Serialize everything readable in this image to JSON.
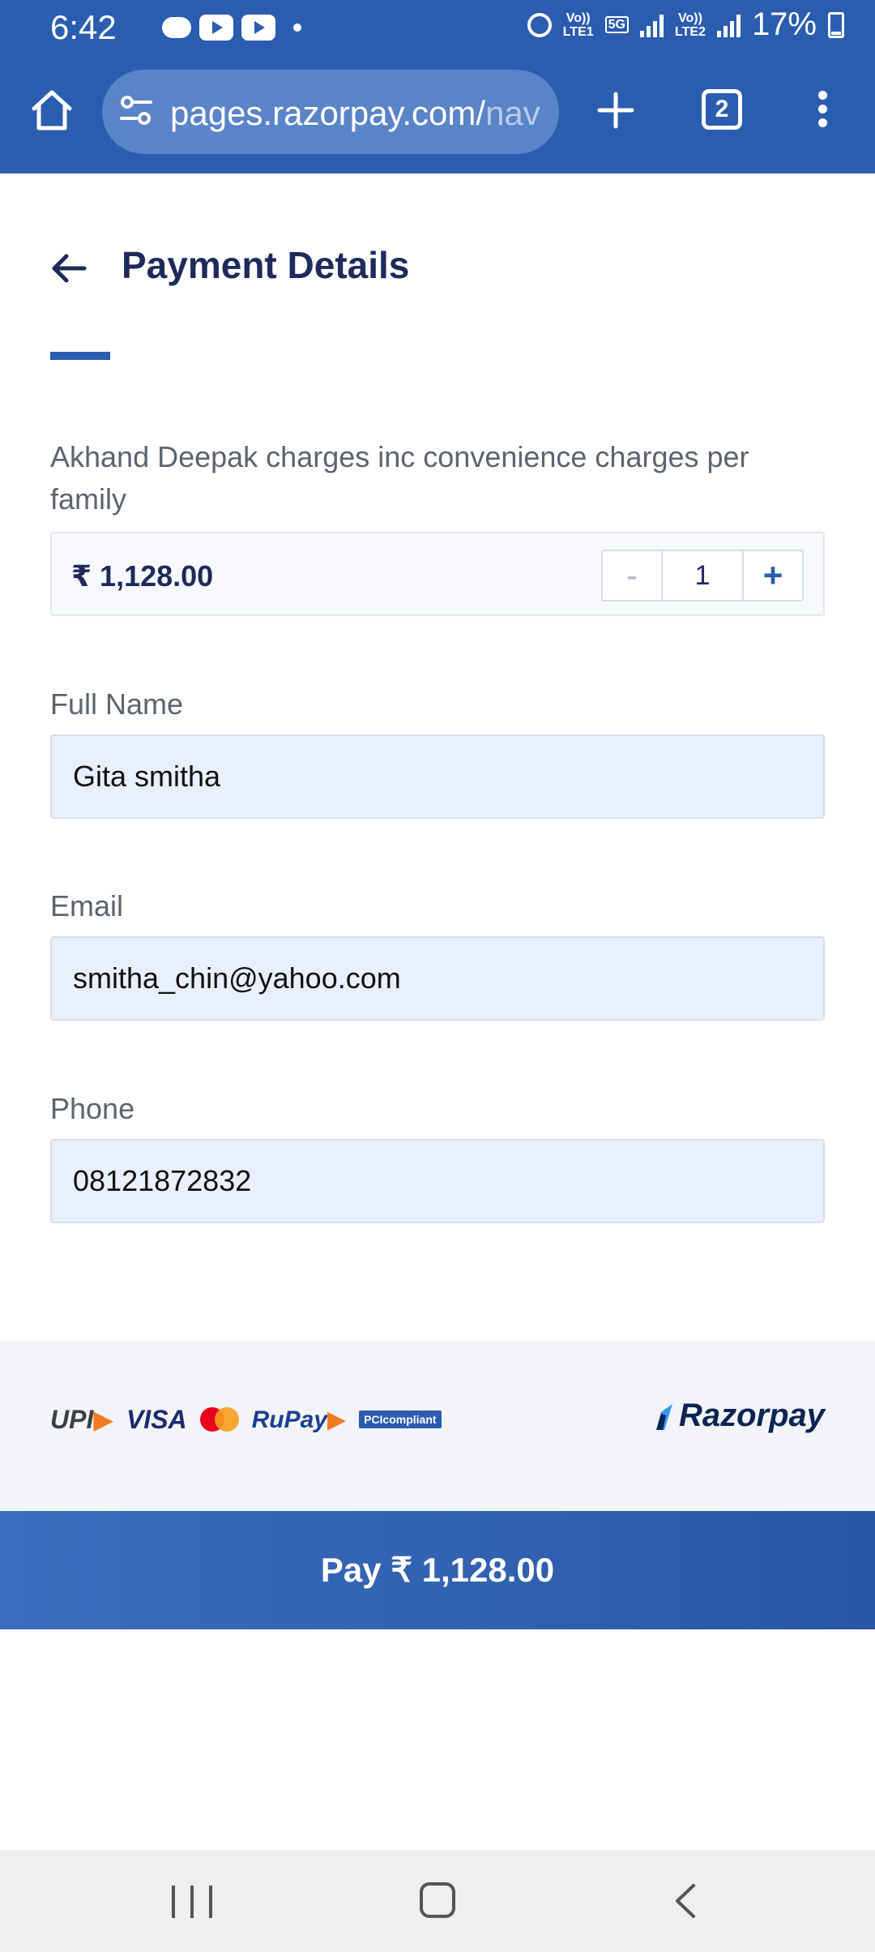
{
  "status_bar": {
    "time": "6:42",
    "net1_top": "Vo))",
    "net1_bottom": "LTE1",
    "net_5g": "5G",
    "net2_top": "Vo))",
    "net2_bottom": "LTE2",
    "battery": "17%"
  },
  "browser": {
    "url_main": "pages.razorpay.com/",
    "url_faded": "nav",
    "tab_count": "2"
  },
  "page": {
    "title": "Payment Details"
  },
  "item": {
    "description": "Akhand Deepak charges inc convenience charges per family",
    "amount": "₹ 1,128.00",
    "quantity": "1",
    "minus": "-",
    "plus": "+"
  },
  "form": {
    "name_label": "Full Name",
    "name_value": "Gita smitha",
    "email_label": "Email",
    "email_value": "smitha_chin@yahoo.com",
    "phone_label": "Phone",
    "phone_value": "08121872832"
  },
  "footer": {
    "upi": "UPI",
    "visa": "VISA",
    "rupay": "RuPay",
    "pci": "PCIcompliant",
    "brand": "Razorpay"
  },
  "pay_button": {
    "label": "Pay  ₹ 1,128.00"
  },
  "colors": {
    "primary": "#2a5db0",
    "title": "#1d2a5b",
    "input_bg": "#e8f0fe"
  }
}
